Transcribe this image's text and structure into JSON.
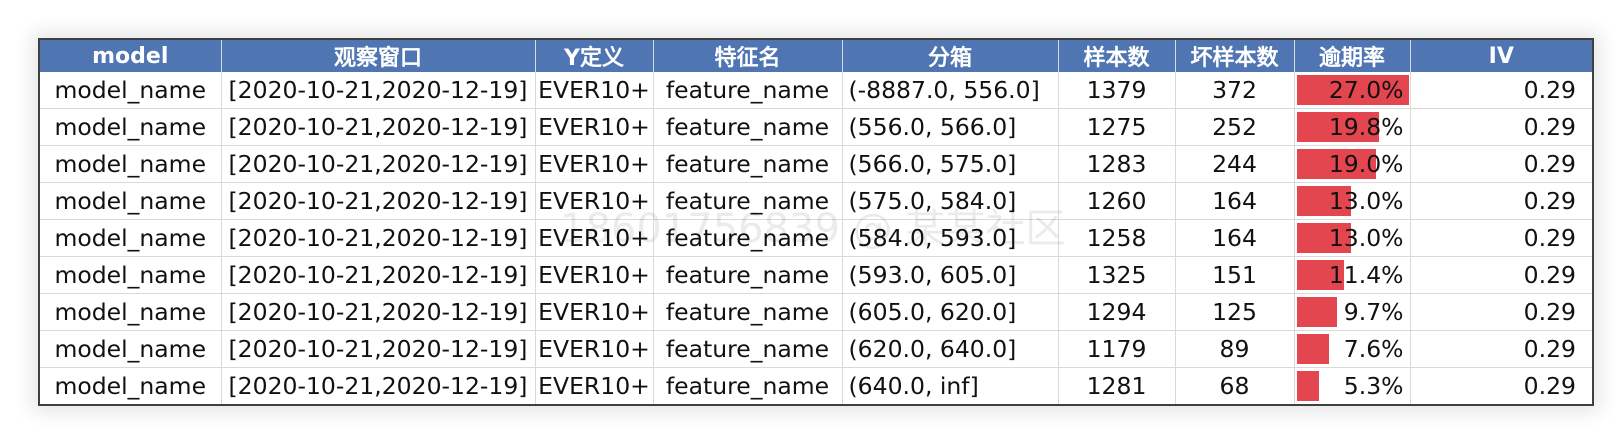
{
  "theme": {
    "header_bg": "#4f75b3",
    "bar_color": "#e3464e"
  },
  "headers": [
    "model",
    "观察窗口",
    "Y定义",
    "特征名",
    "分箱",
    "样本数",
    "坏样本数",
    "逾期率",
    "IV"
  ],
  "rows": [
    {
      "model": "model_name",
      "window": "[2020-10-21,2020-12-19]",
      "y_def": "EVER10+",
      "feature": "feature_name",
      "bin": "(-8887.0, 556.0]",
      "samples": "1379",
      "bad": "372",
      "rate_label": "27.0%",
      "rate": 0.27,
      "iv": "0.29"
    },
    {
      "model": "model_name",
      "window": "[2020-10-21,2020-12-19]",
      "y_def": "EVER10+",
      "feature": "feature_name",
      "bin": "(556.0, 566.0]",
      "samples": "1275",
      "bad": "252",
      "rate_label": "19.8%",
      "rate": 0.198,
      "iv": "0.29"
    },
    {
      "model": "model_name",
      "window": "[2020-10-21,2020-12-19]",
      "y_def": "EVER10+",
      "feature": "feature_name",
      "bin": "(566.0, 575.0]",
      "samples": "1283",
      "bad": "244",
      "rate_label": "19.0%",
      "rate": 0.19,
      "iv": "0.29"
    },
    {
      "model": "model_name",
      "window": "[2020-10-21,2020-12-19]",
      "y_def": "EVER10+",
      "feature": "feature_name",
      "bin": "(575.0, 584.0]",
      "samples": "1260",
      "bad": "164",
      "rate_label": "13.0%",
      "rate": 0.13,
      "iv": "0.29"
    },
    {
      "model": "model_name",
      "window": "[2020-10-21,2020-12-19]",
      "y_def": "EVER10+",
      "feature": "feature_name",
      "bin": "(584.0, 593.0]",
      "samples": "1258",
      "bad": "164",
      "rate_label": "13.0%",
      "rate": 0.13,
      "iv": "0.29"
    },
    {
      "model": "model_name",
      "window": "[2020-10-21,2020-12-19]",
      "y_def": "EVER10+",
      "feature": "feature_name",
      "bin": "(593.0, 605.0]",
      "samples": "1325",
      "bad": "151",
      "rate_label": "11.4%",
      "rate": 0.114,
      "iv": "0.29"
    },
    {
      "model": "model_name",
      "window": "[2020-10-21,2020-12-19]",
      "y_def": "EVER10+",
      "feature": "feature_name",
      "bin": "(605.0, 620.0]",
      "samples": "1294",
      "bad": "125",
      "rate_label": "9.7%",
      "rate": 0.097,
      "iv": "0.29"
    },
    {
      "model": "model_name",
      "window": "[2020-10-21,2020-12-19]",
      "y_def": "EVER10+",
      "feature": "feature_name",
      "bin": "(620.0, 640.0]",
      "samples": "1179",
      "bad": "89",
      "rate_label": "7.6%",
      "rate": 0.076,
      "iv": "0.29"
    },
    {
      "model": "model_name",
      "window": "[2020-10-21,2020-12-19]",
      "y_def": "EVER10+",
      "feature": "feature_name",
      "bin": "(640.0, inf]",
      "samples": "1281",
      "bad": "68",
      "rate_label": "5.3%",
      "rate": 0.053,
      "iv": "0.29"
    }
  ],
  "watermark": "18601756839 @ 某某社区"
}
